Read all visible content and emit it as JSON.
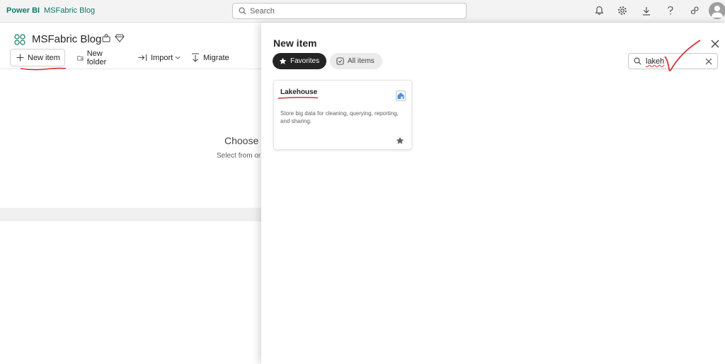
{
  "topbar": {
    "brand": "Power BI",
    "workspace_link": "MSFabric Blog",
    "search_placeholder": "Search",
    "icons": [
      "bell-icon",
      "gear-icon",
      "download-icon",
      "help-icon",
      "share-icon",
      "avatar-icon"
    ]
  },
  "workspace": {
    "title": "MSFabric Blog",
    "toolbar": {
      "new_item": "New item",
      "new_folder": "New folder",
      "import": "Import",
      "migrate": "Migrate"
    },
    "empty_title": "Choose",
    "empty_subtitle": "Select from or"
  },
  "panel": {
    "title": "New item",
    "tabs": [
      {
        "label": "Favorites",
        "active": true
      },
      {
        "label": "All items",
        "active": false
      }
    ],
    "search_value": "lakeh",
    "cards": [
      {
        "title": "Lakehouse",
        "description": "Store big data for cleaning, querying, reporting, and sharing.",
        "favorite": true,
        "icon": "lakehouse-icon"
      }
    ]
  },
  "colors": {
    "brand": "#117865",
    "annotation_red": "#d13438",
    "active_pill": "#242424"
  }
}
